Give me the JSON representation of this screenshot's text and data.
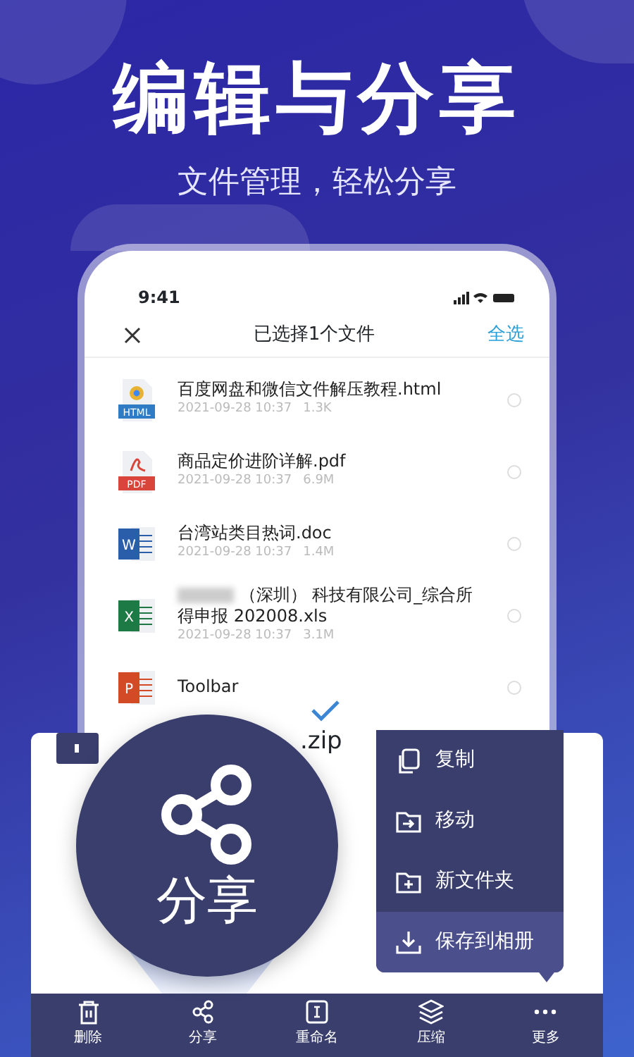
{
  "headline": "编辑与分享",
  "subtitle": "文件管理，轻松分享",
  "phone": {
    "status_time": "9:41",
    "title": "已选择1个文件",
    "select_all": "全选"
  },
  "files": [
    {
      "kind": "html",
      "icon_label": "HTML",
      "name": "百度网盘和微信文件解压教程.html",
      "date": "2021-09-28 10:37",
      "size": "1.3K",
      "redacted": false,
      "selected": false
    },
    {
      "kind": "pdf",
      "icon_label": "PDF",
      "name": "商品定价进阶详解.pdf",
      "date": "2021-09-28 10:37",
      "size": "6.9M",
      "redacted": false,
      "selected": false
    },
    {
      "kind": "doc",
      "icon_label": "W",
      "name": "台湾站类目热词.doc",
      "date": "2021-09-28 10:37",
      "size": "1.4M",
      "redacted": false,
      "selected": false
    },
    {
      "kind": "xls",
      "icon_label": "X",
      "name": "（深圳） 科技有限公司_综合所得申报 202008.xls",
      "date": "2021-09-28 10:37",
      "size": "3.1M",
      "redacted": true,
      "selected": false
    },
    {
      "kind": "ppt",
      "icon_label": "P",
      "name": "Toolbar",
      "redacted": false,
      "selected": false
    }
  ],
  "magnified_row": {
    "name": ".zip"
  },
  "magnifier": {
    "label": "分享"
  },
  "menu": [
    {
      "kind": "copy",
      "label": "复制",
      "selected": false
    },
    {
      "kind": "move",
      "label": "移动",
      "selected": false
    },
    {
      "kind": "new-folder",
      "label": "新文件夹",
      "selected": false
    },
    {
      "kind": "save",
      "label": "保存到相册",
      "selected": true
    }
  ],
  "toolbar": [
    {
      "kind": "delete",
      "label": "删除"
    },
    {
      "kind": "share",
      "label": "分享"
    },
    {
      "kind": "rename",
      "label": "重命名"
    },
    {
      "kind": "compress",
      "label": "压缩"
    },
    {
      "kind": "more",
      "label": "更多"
    }
  ]
}
